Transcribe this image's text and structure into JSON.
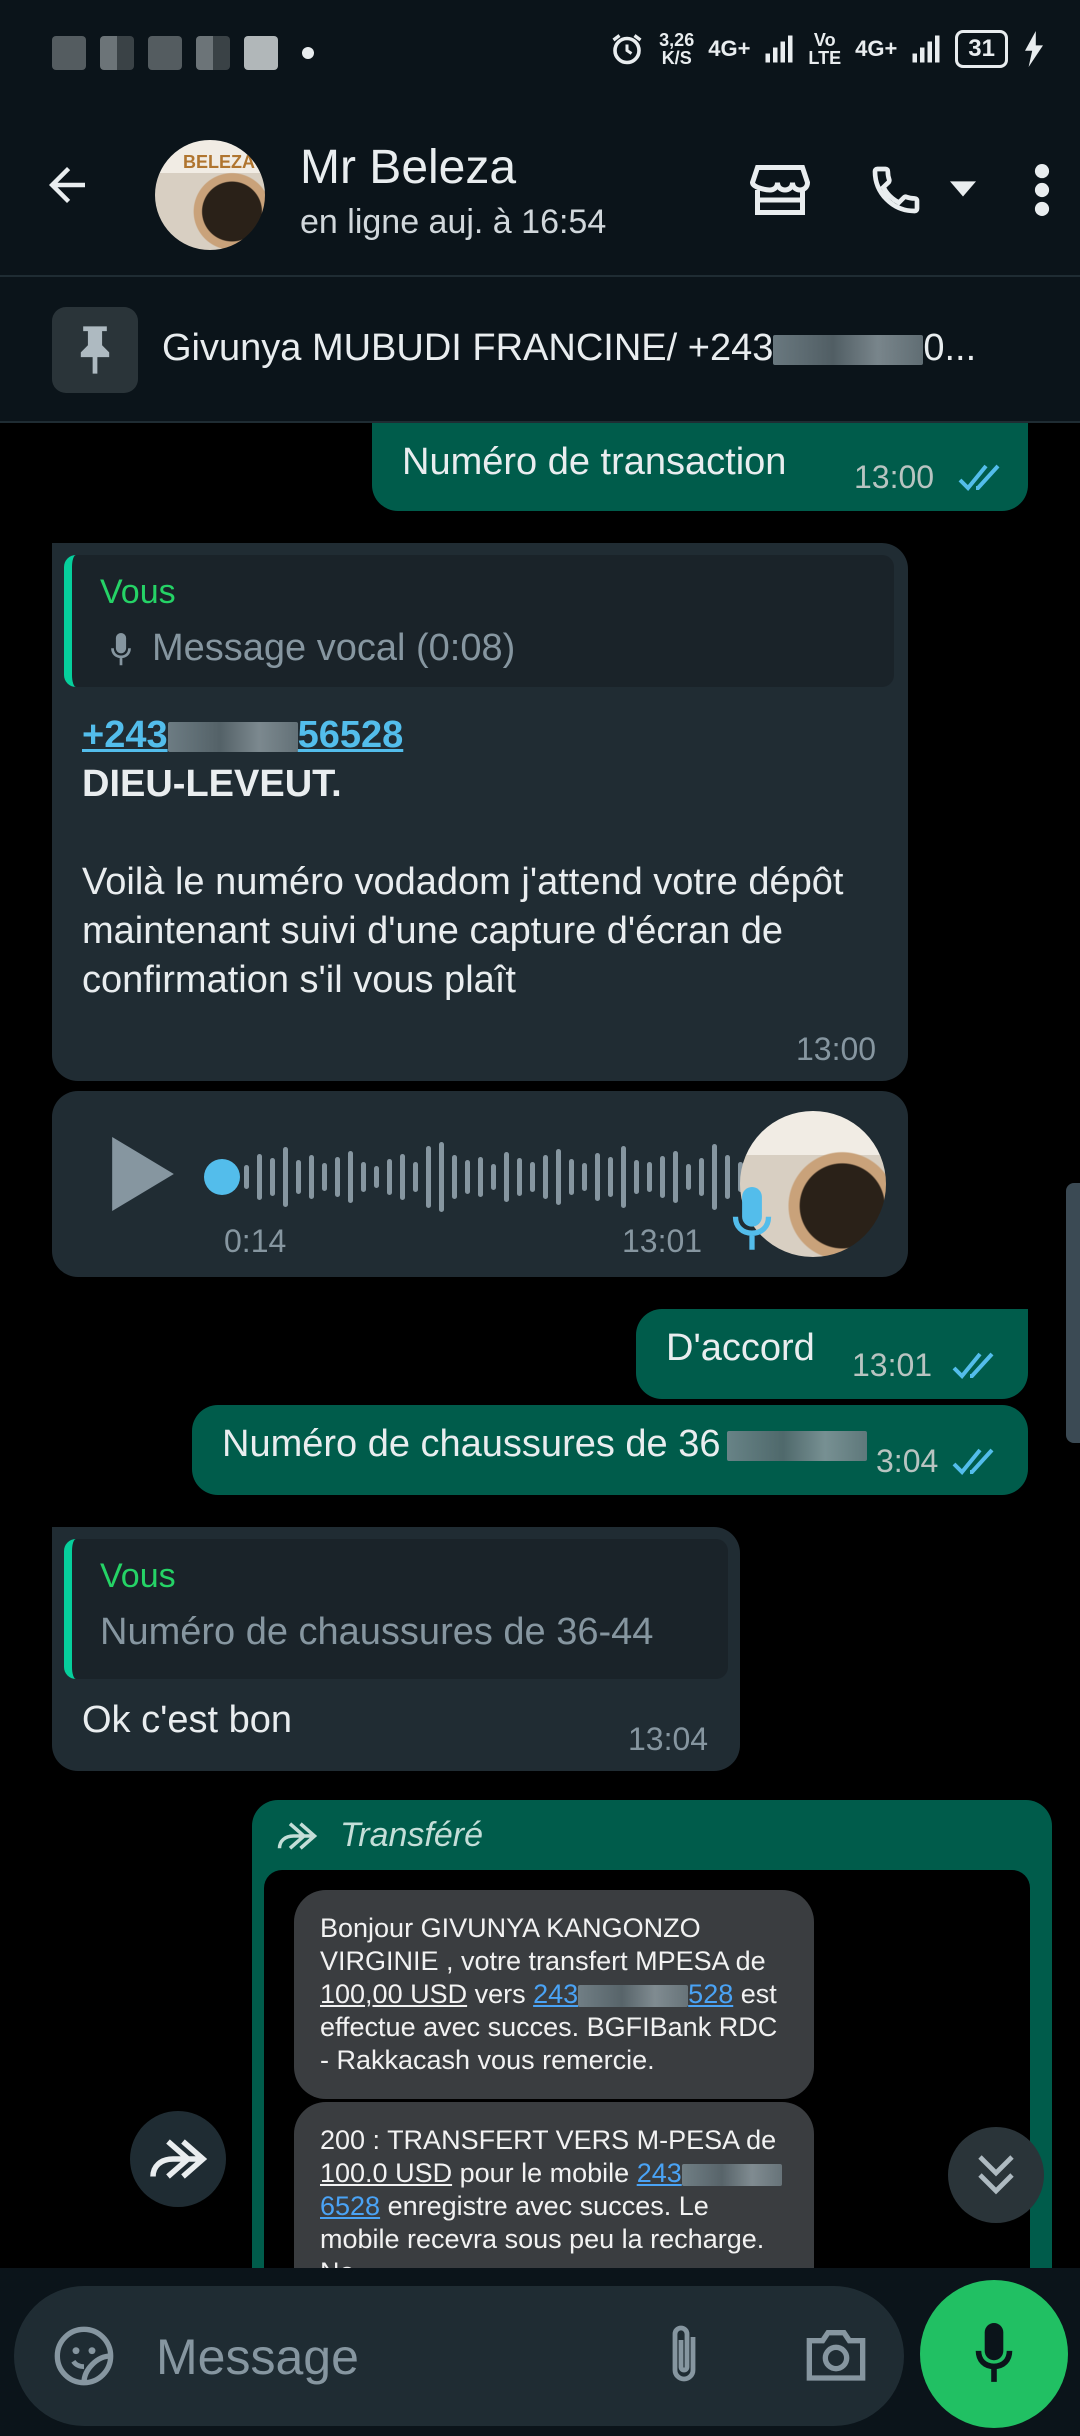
{
  "status_bar": {
    "speed_value": "3,26",
    "speed_unit": "K/S",
    "net1": "4G+",
    "net2": "Vo\nLTE",
    "net3": "4G+",
    "battery": "31"
  },
  "header": {
    "contact_name": "Mr Beleza",
    "last_seen": "en ligne auj. à 16:54",
    "avatar_text": "BELEZA"
  },
  "pinned": {
    "text_prefix": "Givunya MUBUDI FRANCINE/ +243",
    "text_suffix": "0..."
  },
  "messages": {
    "m1": {
      "text": "Numéro de transaction",
      "time": "13:00"
    },
    "m2": {
      "quote_name": "Vous",
      "quote_text": "Message vocal (0:08)",
      "phone_prefix": "+243",
      "phone_suffix": "56528",
      "bold_line": "DIEU-LEVEUT.",
      "body": "Voilà le numéro vodadom j'attend votre dépôt maintenant suivi d'une capture d'écran de confirmation s'il vous plaît",
      "time": "13:00"
    },
    "voice": {
      "duration": "0:14",
      "time": "13:01"
    },
    "m3": {
      "text": "D'accord",
      "time": "13:01"
    },
    "m4": {
      "text": "Numéro de chaussures de 36",
      "time_suffix": "3:04"
    },
    "m5": {
      "quote_name": "Vous",
      "quote_text": "Numéro de chaussures de 36-44",
      "text": "Ok c'est bon",
      "time": "13:04"
    },
    "forwarded": {
      "label": "Transféré",
      "sms1_a": "Bonjour GIVUNYA KANGONZO VIRGINIE , votre transfert MPESA de ",
      "sms1_amount": "100,00 USD",
      "sms1_b": " vers ",
      "sms1_num_prefix": "243",
      "sms1_num_suffix": "528",
      "sms1_c": " est effectue avec succes. BGFIBank RDC - Rakkacash vous remercie.",
      "sms2_a": "200 : TRANSFERT VERS M-PESA de ",
      "sms2_amount": "100.0 USD",
      "sms2_b": " pour le mobile ",
      "sms2_num_prefix": "243",
      "sms2_num_suffix": "6528",
      "sms2_c": " enregistre avec succes. Le mobile recevra sous peu la recharge. No"
    }
  },
  "input": {
    "placeholder": "Message"
  },
  "colors": {
    "outgoing": "#005c4b",
    "incoming": "#202c33",
    "accent": "#25d366",
    "ticks": "#53bdeb"
  }
}
